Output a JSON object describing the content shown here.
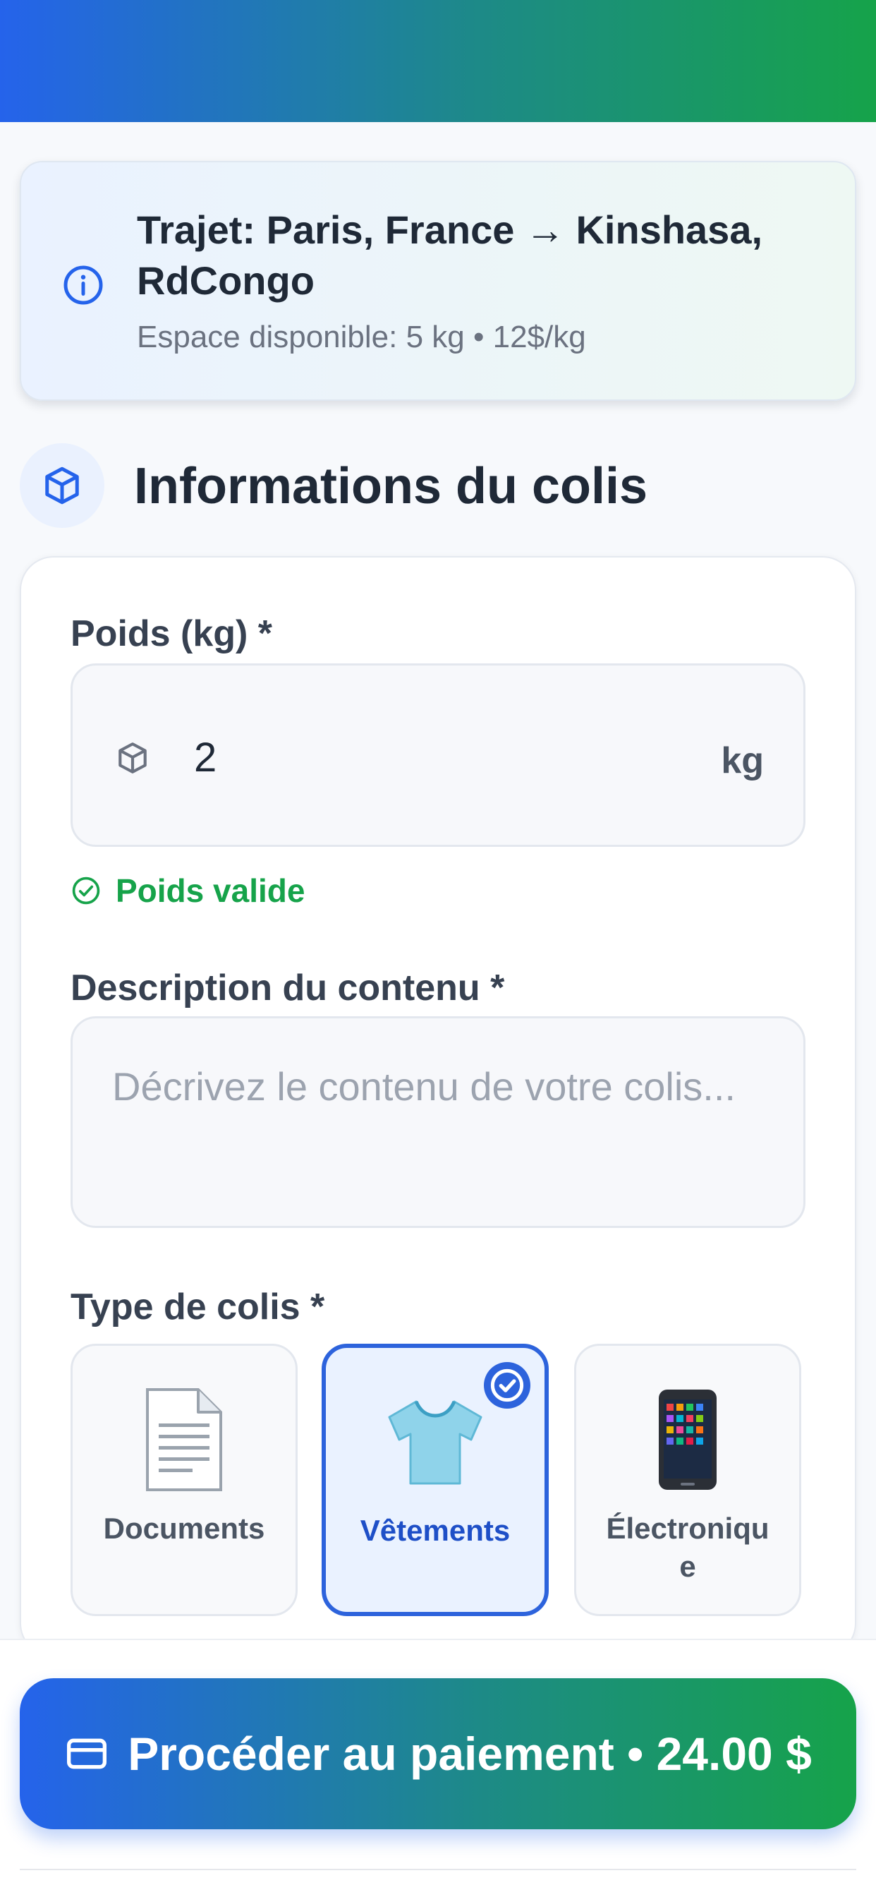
{
  "route": {
    "title": "Trajet: Paris, France → Kinshasa, RdCongo",
    "subtitle": "Espace disponible: 5 kg • 12$/kg"
  },
  "section": {
    "title": "Informations du colis"
  },
  "weight": {
    "label": "Poids (kg) *",
    "value": "2",
    "unit": "kg",
    "validation": "Poids valide"
  },
  "description": {
    "label": "Description du contenu *",
    "placeholder": "Décrivez le contenu de votre colis..."
  },
  "package_type": {
    "label": "Type de colis *",
    "options": [
      {
        "label": "Documents",
        "icon": "document-icon",
        "selected": false
      },
      {
        "label": "Vêtements",
        "icon": "tshirt-icon",
        "selected": true
      },
      {
        "label": "Électronique",
        "icon": "smartphone-icon",
        "selected": false
      }
    ]
  },
  "payment": {
    "button_label": "Procéder au paiement • 24.00 $"
  },
  "colors": {
    "primary_blue": "#2563eb",
    "accent_green": "#16a34a",
    "selected_border": "#2d63dc"
  }
}
